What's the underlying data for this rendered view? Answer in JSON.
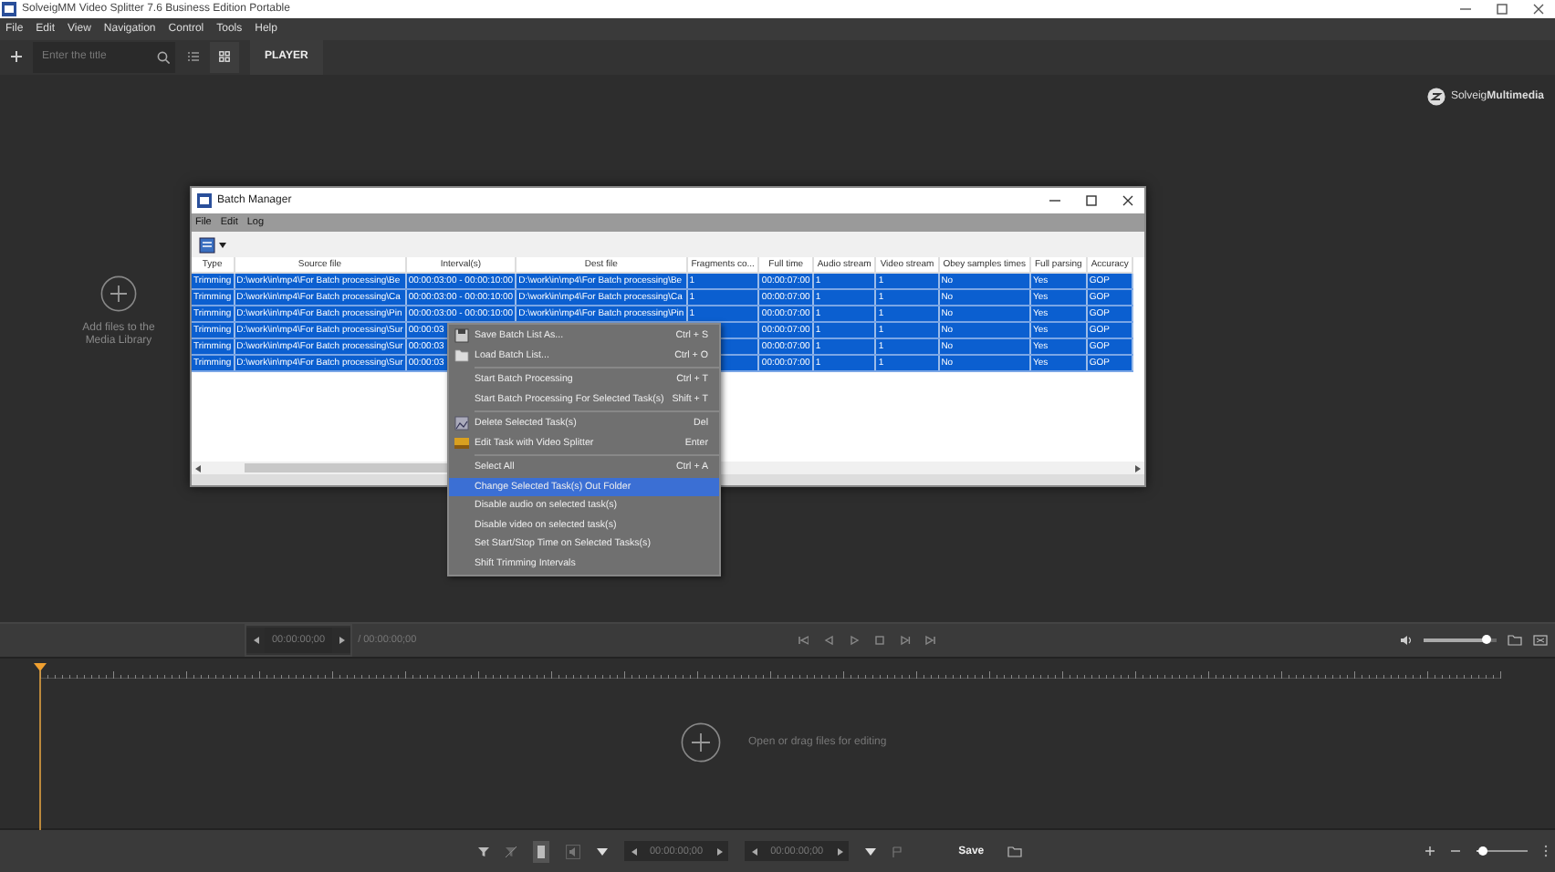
{
  "window": {
    "title": "SolveigMM Video Splitter 7.6 Business Edition Portable"
  },
  "menu": [
    "File",
    "Edit",
    "View",
    "Navigation",
    "Control",
    "Tools",
    "Help"
  ],
  "toolbar": {
    "search": {
      "placeholder": "Enter the title"
    },
    "view_modes": [
      {
        "kind": "list",
        "selected": false
      },
      {
        "kind": "grid",
        "selected": true
      }
    ],
    "tabs": [
      {
        "label": "PLAYER",
        "selected": true
      }
    ]
  },
  "library": {
    "hint": "Add files to the Media Library"
  },
  "logo": {
    "text": "Solveig**Multimedia**"
  },
  "batch_manager": {
    "title": "Batch Manager",
    "menu": [
      "File",
      "Edit",
      "Log"
    ],
    "columns": [
      "Type",
      "Source file",
      "Interval(s)",
      "Dest file",
      "Fragments co...",
      "Full time",
      "Audio stream",
      "Video stream",
      "Obey samples times",
      "Full parsing",
      "Accuracy"
    ],
    "rows": [
      {
        "selected": true,
        "type": "Trimming",
        "source": "D:\\work\\in\\mp4\\For Batch processing\\Be",
        "interval": "00:00:03:00 - 00:00:10:00",
        "dest": "D:\\work\\in\\mp4\\For Batch processing\\Be",
        "fragments": "1",
        "full_time": "00:00:07:00",
        "audio": "1",
        "video": "1",
        "obey": "No",
        "full_parsing": "Yes",
        "accuracy": "GOP"
      },
      {
        "selected": true,
        "type": "Trimming",
        "source": "D:\\work\\in\\mp4\\For Batch processing\\Ca",
        "interval": "00:00:03:00 - 00:00:10:00",
        "dest": "D:\\work\\in\\mp4\\For Batch processing\\Ca",
        "fragments": "1",
        "full_time": "00:00:07:00",
        "audio": "1",
        "video": "1",
        "obey": "No",
        "full_parsing": "Yes",
        "accuracy": "GOP"
      },
      {
        "selected": true,
        "type": "Trimming",
        "source": "D:\\work\\in\\mp4\\For Batch processing\\Pin",
        "interval": "00:00:03:00 - 00:00:10:00",
        "dest": "D:\\work\\in\\mp4\\For Batch processing\\Pin",
        "fragments": "1",
        "full_time": "00:00:07:00",
        "audio": "1",
        "video": "1",
        "obey": "No",
        "full_parsing": "Yes",
        "accuracy": "GOP"
      },
      {
        "selected": true,
        "type": "Trimming",
        "source": "D:\\work\\in\\mp4\\For Batch processing\\Sur",
        "interval": "00:00:03",
        "full_time": "00:00:07:00",
        "audio": "1",
        "video": "1",
        "obey": "No",
        "full_parsing": "Yes",
        "accuracy": "GOP"
      },
      {
        "selected": true,
        "type": "Trimming",
        "source": "D:\\work\\in\\mp4\\For Batch processing\\Sur",
        "interval": "00:00:03",
        "full_time": "00:00:07:00",
        "audio": "1",
        "video": "1",
        "obey": "No",
        "full_parsing": "Yes",
        "accuracy": "GOP"
      },
      {
        "selected": true,
        "type": "Trimming",
        "source": "D:\\work\\in\\mp4\\For Batch processing\\Sur",
        "interval": "00:00:03",
        "full_time": "00:00:07:00",
        "audio": "1",
        "video": "1",
        "obey": "No",
        "full_parsing": "Yes",
        "accuracy": "GOP"
      }
    ]
  },
  "context_menu": [
    {
      "kind": "floppy",
      "label": "Save Batch List As...",
      "shortcut": "Ctrl + S",
      "selected": false
    },
    {
      "kind": "folder",
      "label": "Load Batch List...",
      "shortcut": "Ctrl + O",
      "selected": false
    },
    {
      "kind": "separator"
    },
    {
      "kind": "item",
      "label": "Start Batch Processing",
      "shortcut": "Ctrl + T",
      "selected": false
    },
    {
      "kind": "item",
      "label": "Start Batch Processing For Selected Task(s)",
      "shortcut": "Shift + T",
      "selected": false
    },
    {
      "kind": "separator"
    },
    {
      "kind": "image",
      "label": "Delete Selected Task(s)",
      "shortcut": "Del",
      "selected": false
    },
    {
      "kind": "film",
      "label": "Edit Task with Video Splitter",
      "shortcut": "Enter",
      "selected": false
    },
    {
      "kind": "separator"
    },
    {
      "kind": "item",
      "label": "Select All",
      "shortcut": "Ctrl + A",
      "selected": false
    },
    {
      "kind": "item",
      "label": "Change Selected Task(s) Out Folder",
      "selected": true
    },
    {
      "kind": "item",
      "label": "Disable audio on selected task(s)",
      "selected": false
    },
    {
      "kind": "item",
      "label": "Disable video on selected task(s)",
      "selected": false
    },
    {
      "kind": "item",
      "label": "Set Start/Stop Time on Selected Tasks(s)",
      "selected": false
    },
    {
      "kind": "item",
      "label": "Shift Trimming Intervals",
      "selected": false
    }
  ],
  "player": {
    "position": "00:00:00;00",
    "duration": "/ 00:00:00;00",
    "volume": {
      "level": 0.85
    }
  },
  "timeline": {
    "hint": "Open or drag files for editing"
  },
  "bottom_bar": {
    "start": "00:00:00;00",
    "end": "00:00:00;00",
    "save": "Save",
    "zoom": {
      "level": 0.1
    }
  }
}
